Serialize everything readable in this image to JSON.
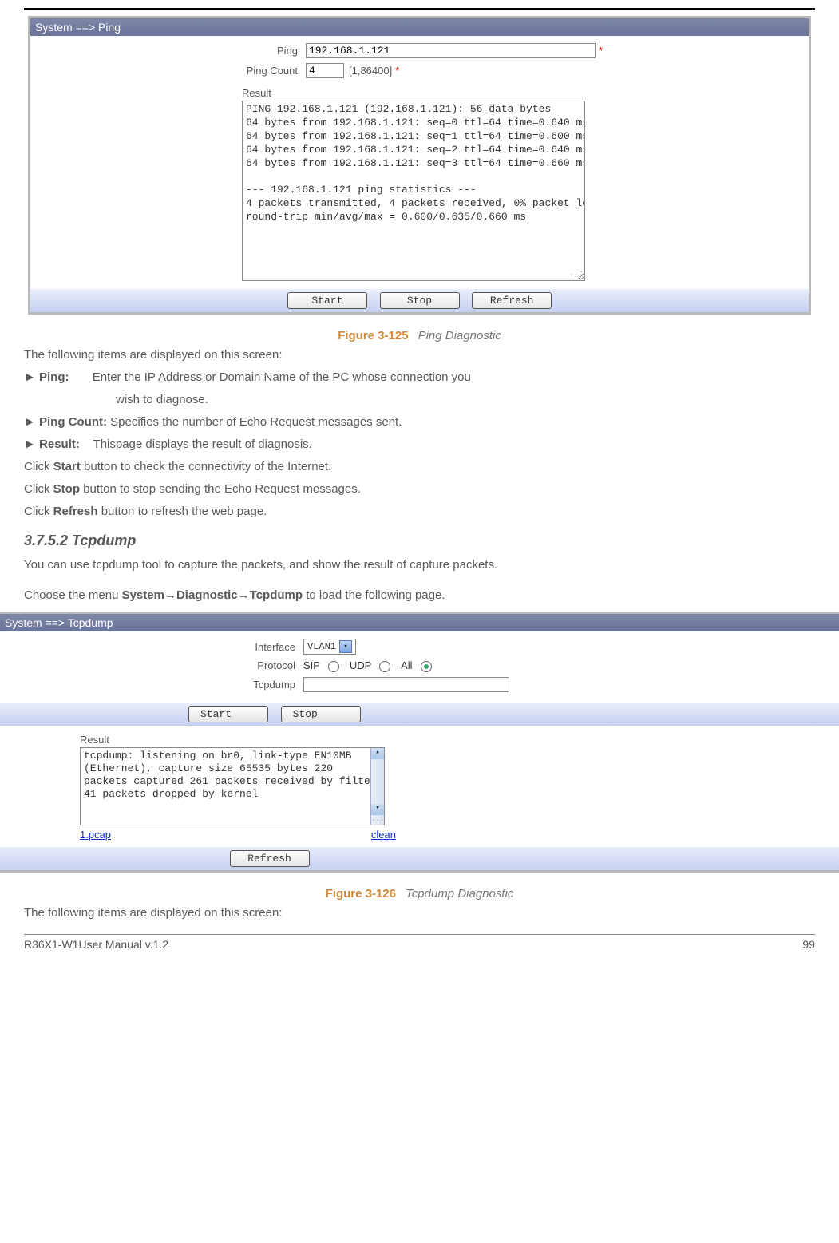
{
  "ping_ui": {
    "title": "System ==> Ping",
    "ping_label": "Ping",
    "ping_value": "192.168.1.121",
    "count_label": "Ping Count",
    "count_value": "4",
    "count_hint": "[1,86400]",
    "result_label": "Result",
    "result_text": "PING 192.168.1.121 (192.168.1.121): 56 data bytes\n64 bytes from 192.168.1.121: seq=0 ttl=64 time=0.640 ms\n64 bytes from 192.168.1.121: seq=1 ttl=64 time=0.600 ms\n64 bytes from 192.168.1.121: seq=2 ttl=64 time=0.640 ms\n64 bytes from 192.168.1.121: seq=3 ttl=64 time=0.660 ms\n\n--- 192.168.1.121 ping statistics ---\n4 packets transmitted, 4 packets received, 0% packet loss\nround-trip min/avg/max = 0.600/0.635/0.660 ms",
    "btn_start": "Start",
    "btn_stop": "Stop",
    "btn_refresh": "Refresh"
  },
  "fig125": {
    "num": "Figure 3-125",
    "title": "Ping Diagnostic"
  },
  "text1": {
    "intro": "The following items are displayed on this screen:",
    "ping_lbl": "► Ping:",
    "ping_desc1": "Enter the IP Address or Domain Name of the PC whose connection you",
    "ping_desc2": "wish to diagnose.",
    "count_lbl": "► Ping Count:",
    "count_desc": " Specifies the number of Echo Request messages sent.",
    "result_lbl": "► Result:",
    "result_desc": "Thispage displays the result of diagnosis.",
    "click1a": "Click ",
    "click1b": "Start",
    "click1c": " button to check the connectivity of the Internet.",
    "click2a": "Click ",
    "click2b": "Stop",
    "click2c": " button to stop sending the Echo Request messages.",
    "click3a": "Click ",
    "click3b": "Refresh",
    "click3c": " button to refresh the web page."
  },
  "sec_head": "3.7.5.2  Tcpdump",
  "text2": {
    "p1": "You can use tcpdump tool to capture the packets, and show the result of capture packets.",
    "nav1": "Choose the menu ",
    "nav2": "System",
    "nav3": "→",
    "nav4": "Diagnostic",
    "nav5": "→",
    "nav6": "Tcpdump",
    "nav7": " to load the following page."
  },
  "tcpdump_ui": {
    "title": "System ==> Tcpdump",
    "if_label": "Interface",
    "if_value": "VLAN1",
    "proto_label": "Protocol",
    "proto_sip": "SIP",
    "proto_udp": "UDP",
    "proto_all": "All",
    "tcpdump_label": "Tcpdump",
    "tcpdump_value": "",
    "btn_start": "Start",
    "btn_stop": "Stop",
    "result_label": "Result",
    "result_text": "tcpdump: listening on br0, link-type EN10MB\n(Ethernet), capture size 65535 bytes\n220 packets captured\n261 packets received by filter\n41 packets dropped by kernel",
    "link_pcap": "1.pcap",
    "link_clean": "clean",
    "btn_refresh": "Refresh"
  },
  "fig126": {
    "num": "Figure 3-126",
    "title": "Tcpdump Diagnostic"
  },
  "outro": "The following items are displayed on this screen:",
  "footer_left": "R36X1-W1User Manual v.1.2",
  "footer_right": "99"
}
